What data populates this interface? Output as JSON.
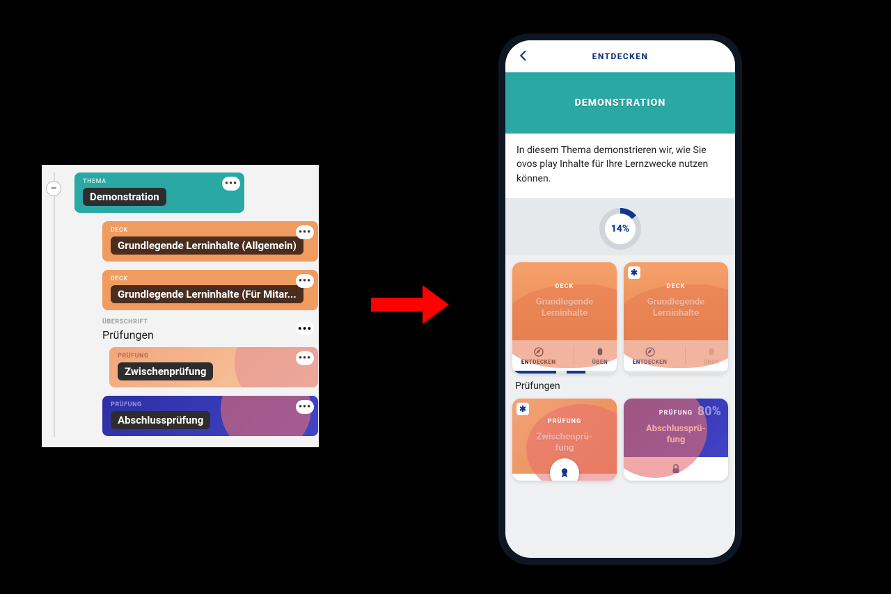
{
  "editor": {
    "collapse_glyph": "–",
    "thema": {
      "tag": "THEMA",
      "label": "Demonstration"
    },
    "decks": [
      {
        "tag": "DECK",
        "label": "Grundlegende Lerninhalte (Allgemein)"
      },
      {
        "tag": "DECK",
        "label": "Grundlegende Lerninhalte (Für Mitar..."
      }
    ],
    "section": {
      "tag": "ÜBERSCHRIFT",
      "title": "Prüfungen"
    },
    "pruefungen": [
      {
        "tag": "PRÜFUNG",
        "label": "Zwischenprüfung"
      },
      {
        "tag": "PRÜFUNG",
        "label": "Abschlussprüfung"
      }
    ],
    "menu_dots": "•••"
  },
  "phone": {
    "top_title": "ENTDECKEN",
    "banner": "DEMONSTRATION",
    "lead_text": "In diesem Thema demonstrieren wir, wie Sie ovos play Inhalte für Ihre Lernzwecke nutzen können.",
    "progress_label": "14%",
    "decks": [
      {
        "tag": "DECK",
        "name": "Grundlegende Lerninhalte",
        "action_discover": "ENTDECKEN",
        "action_practice": "ÜBEN",
        "has_star": false,
        "practice_enabled": true
      },
      {
        "tag": "DECK",
        "name": "Grundlegende Lerninhalte",
        "action_discover": "ENTDECKEN",
        "action_practice": "ÜBEN",
        "has_star": true,
        "practice_enabled": false
      }
    ],
    "section_title": "Prüfungen",
    "pruefungen": [
      {
        "tag": "PRÜFUNG",
        "name": "Zwischenprü-\nfung",
        "has_star": true,
        "percent": "",
        "bg": "pruef1"
      },
      {
        "tag": "PRÜFUNG",
        "name": "Abschlussprü-\nfung",
        "has_star": false,
        "percent": "80%",
        "bg": "pruef2"
      }
    ]
  },
  "icons": {
    "star_glyph": "✱"
  }
}
